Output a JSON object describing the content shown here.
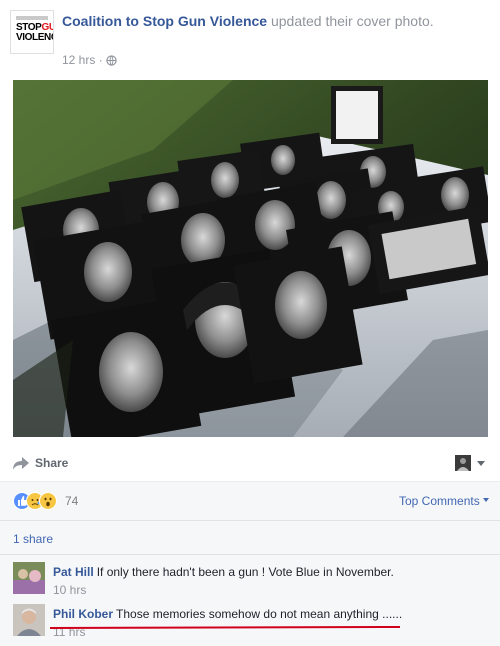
{
  "post": {
    "page_name": "Coalition to Stop Gun Violence",
    "action": " updated their cover photo.",
    "timestamp": "12 hrs",
    "separator": " · ",
    "avatar_logo": {
      "line1_a": "STOP",
      "line1_b": "GUN",
      "line2": "VIOLENCE"
    }
  },
  "actions": {
    "share_label": "Share",
    "share_icon": "share-arrow-icon",
    "actor_icon": "actor-selector-icon"
  },
  "reactions": {
    "types": [
      "like",
      "sad",
      "wow"
    ],
    "count": "74",
    "like_color": "#5890ff",
    "sad_color": "#f7c744"
  },
  "sort": {
    "label": "Top Comments"
  },
  "shares": {
    "label": "1 share"
  },
  "comments": [
    {
      "author": "Pat Hill",
      "text": "If only there hadn't been a gun ! Vote Blue in November.",
      "time": "10 hrs"
    },
    {
      "author": "Phil Kober",
      "text": "Those memories somehow do not mean anything ......",
      "time": "11 hrs"
    }
  ],
  "colors": {
    "link": "#365899",
    "accent": "#4267b2",
    "annotation_red": "#d0021b"
  }
}
